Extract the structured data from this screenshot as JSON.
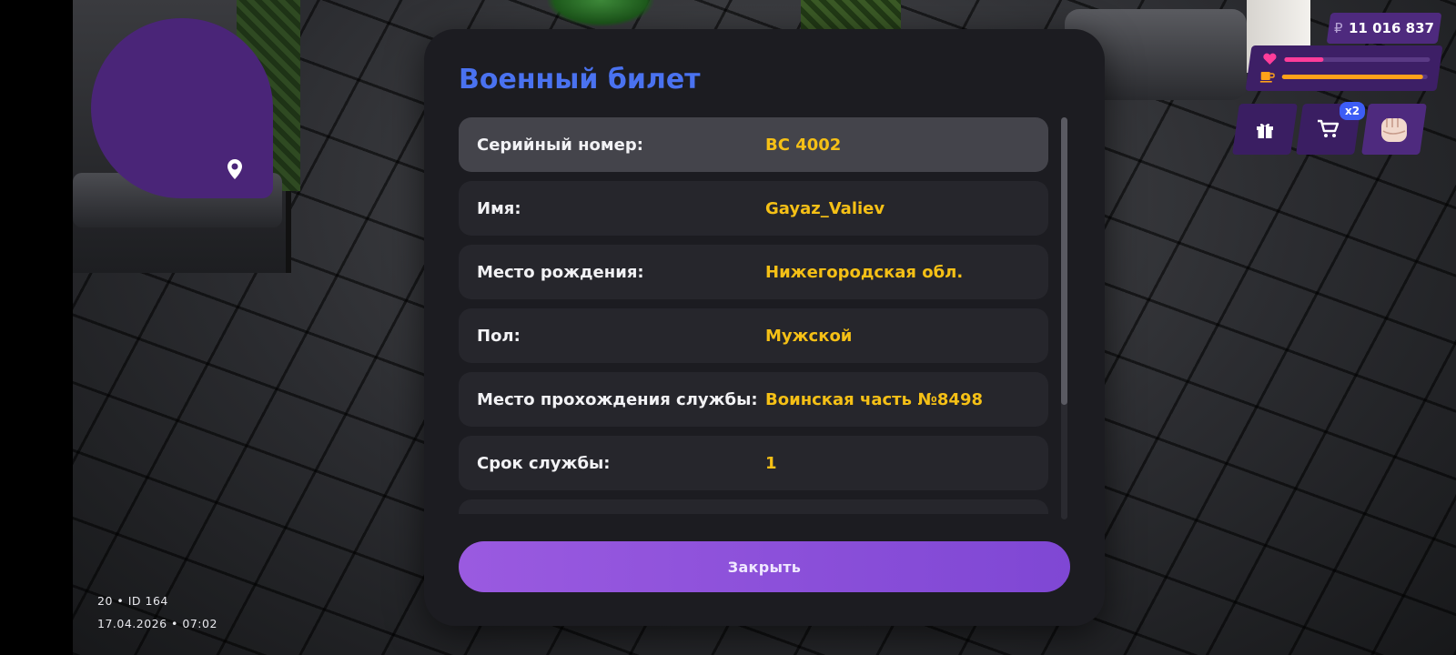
{
  "hud": {
    "money_currency": "₽",
    "money_amount": "11 016 837",
    "health_level": 0.27,
    "hunger_level": 0.97,
    "cart_badge": "x2",
    "colors": {
      "health": "#ff3d9a",
      "hunger": "#ffa21a",
      "panel": "#3d1f66"
    }
  },
  "session": {
    "line1": "20 • ID 164",
    "line2": "17.04.2026 • 07:02"
  },
  "dialog": {
    "title": "Военный билет",
    "rows": [
      {
        "label": "Серийный номер:",
        "value": "ВС 4002"
      },
      {
        "label": "Имя:",
        "value": "Gayaz_Valiev"
      },
      {
        "label": "Место рождения:",
        "value": "Нижегородская обл."
      },
      {
        "label": "Пол:",
        "value": "Мужской"
      },
      {
        "label": "Место прохождения службы:",
        "value": "Воинская часть №8498"
      },
      {
        "label": "Срок службы:",
        "value": "1"
      }
    ],
    "close_label": "Закрыть",
    "scroll_position": 0.0,
    "colors": {
      "title": "#4a72f0",
      "value": "#f5c016",
      "button": "#8a4fdb"
    }
  }
}
